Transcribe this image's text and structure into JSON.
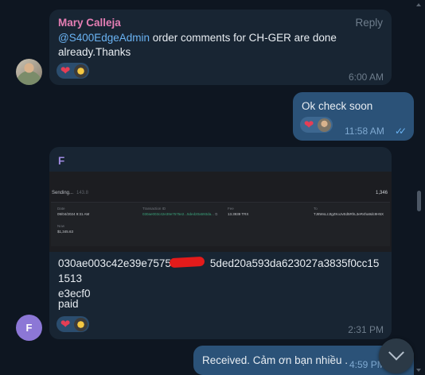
{
  "messages": [
    {
      "sender": "Mary Calleja",
      "reply_label": "Reply",
      "mention": "@S400EdgeAdmin",
      "text": " order comments for CH-GER are done already.Thanks",
      "time": "6:00 AM"
    },
    {
      "text": "Ok check soon",
      "time": "11:58 AM",
      "status_icon": "double-check-icon"
    },
    {
      "sender": "F",
      "avatar_letter": "F",
      "screenshot": {
        "title": "Sending...",
        "title_dim": "143.8",
        "amount_right": "1,346",
        "date_label": "Date",
        "date_value": "09/04/2024 9:31 AM",
        "txid_label": "Transaction ID",
        "txid_value": "030ae003c42e39e7575e2...5ded20a593da...",
        "fee_label": "Fee",
        "fee_value": "13.3939 TRX",
        "to_label": "To",
        "to_value": "TJ8WxLzJtgZKoJvEd5RhL3eR4ha9dc9H5X",
        "now_label": "Now",
        "now_value": "$1,345.63"
      },
      "hash_line1": "030ae003c42e39e7575e2",
      "hash_hidden": "",
      "hash_line1b": "5ded20a593da623027a3835f0cc151513",
      "hash_line2": "e3ecf0",
      "paid": "paid",
      "time": "2:31 PM"
    },
    {
      "text": "Received. Cảm ơn bạn nhiều .",
      "time": "4:59 PM"
    }
  ],
  "colors": {
    "background": "#0e1621",
    "incoming": "#182533",
    "outgoing": "#2b5278",
    "sender_mary": "#e57eb4",
    "sender_f": "#9e8ae0",
    "link": "#6ab3f3"
  }
}
